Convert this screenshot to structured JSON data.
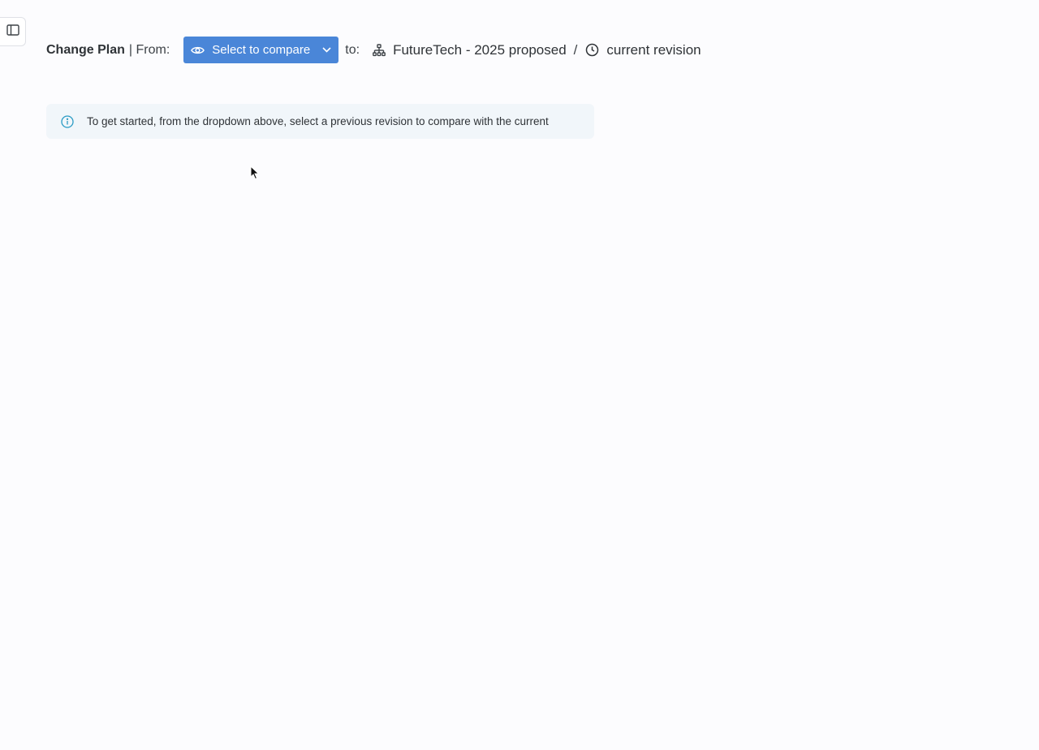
{
  "sidebar_toggle": {
    "icon": "sidebar-panel-icon"
  },
  "header": {
    "title": "Change Plan",
    "from_label": "| From:",
    "compare_button": {
      "label": "Select to compare",
      "icon": "eye-icon",
      "dropdown_icon": "chevron-down-icon"
    },
    "to_label": "to:",
    "target": {
      "icon": "org-chart-icon",
      "name": "FutureTech - 2025 proposed"
    },
    "separator": "/",
    "revision": {
      "icon": "clock-icon",
      "label": "current revision"
    }
  },
  "info_banner": {
    "icon": "info-icon",
    "text": "To get started, from the dropdown above, select a previous revision to compare with the current"
  },
  "colors": {
    "background": "#fcfcfe",
    "button_blue": "#4a86d8",
    "info_bg": "#f1f6fa",
    "info_icon": "#2a9bc4"
  }
}
